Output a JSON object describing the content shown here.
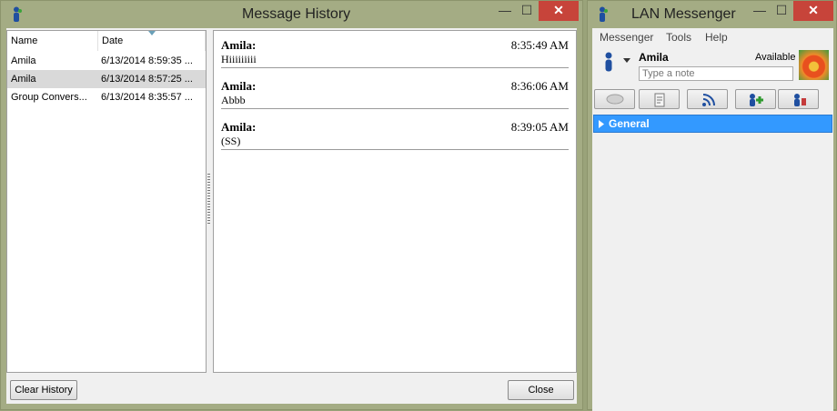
{
  "message_history": {
    "title": "Message History",
    "columns": [
      "Name",
      "Date"
    ],
    "conversations": [
      {
        "name": "Amila",
        "date": "6/13/2014 8:59:35 ..."
      },
      {
        "name": "Amila",
        "date": "6/13/2014 8:57:25 ..."
      },
      {
        "name": "Group Convers...",
        "date": "6/13/2014 8:35:57 ..."
      }
    ],
    "selected_index": 1,
    "messages": [
      {
        "sender": "Amila:",
        "time": "8:35:49 AM",
        "text": "Hiiiiiiiii"
      },
      {
        "sender": "Amila:",
        "time": "8:36:06 AM",
        "text": "Abbb"
      },
      {
        "sender": "Amila:",
        "time": "8:39:05 AM",
        "text": "(SS)"
      }
    ],
    "clear_history_label": "Clear History",
    "close_label": "Close",
    "window_buttons": {
      "minimize": "—",
      "maximize": "☐",
      "close": "✕"
    }
  },
  "lan_messenger": {
    "title": "LAN Messenger",
    "menu": [
      "Messenger",
      "Tools",
      "Help"
    ],
    "user_name": "Amila",
    "status": "Available",
    "note_placeholder": "Type a note",
    "group_name": "General",
    "window_buttons": {
      "minimize": "—",
      "maximize": "☐",
      "close": "✕"
    }
  },
  "colors": {
    "selection_blue": "#3399ff",
    "title_bar": "#a4ac84",
    "close_red": "#c7443a"
  }
}
